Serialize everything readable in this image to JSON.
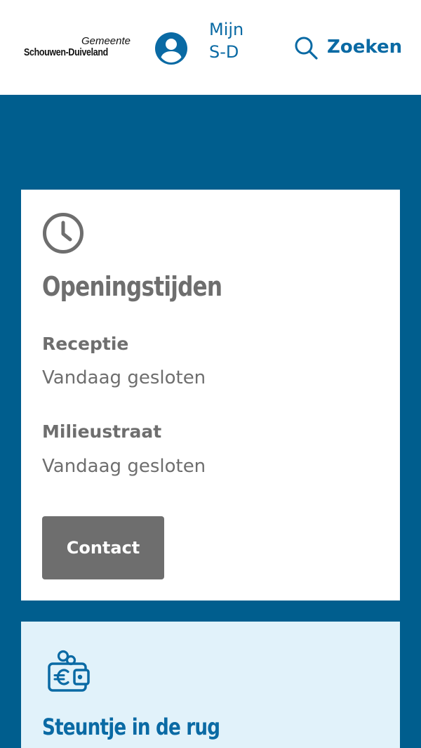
{
  "header": {
    "logo": {
      "line1": "Gemeente",
      "line2": "Schouwen-Duiveland"
    },
    "account_link": {
      "label_line1": "Mijn",
      "label_line2": "S-D",
      "icon": "user-circle-icon"
    },
    "search_link": {
      "label": "Zoeken",
      "icon": "search-icon"
    }
  },
  "opening_hours": {
    "icon": "clock-icon",
    "title": "Openingstijden",
    "locations": [
      {
        "name": "Receptie",
        "status": "Vandaag gesloten"
      },
      {
        "name": "Milieustraat",
        "status": "Vandaag gesloten"
      }
    ],
    "button_label": "Contact"
  },
  "support_card": {
    "icon": "wallet-euro-icon",
    "title": "Steuntje in de rug"
  },
  "colors": {
    "brand_blue": "#005e8e",
    "link_blue": "#0a6aa4",
    "card_gray": "#6e6e6e",
    "light_blue_card": "#e1f2fa",
    "white": "#ffffff"
  }
}
